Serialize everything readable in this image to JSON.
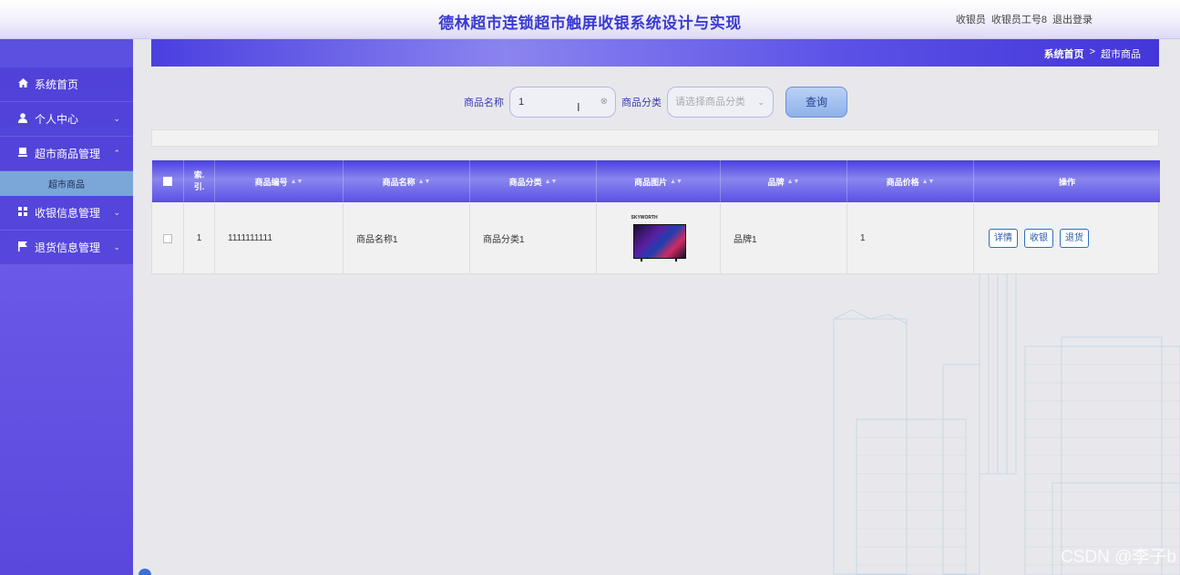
{
  "header": {
    "title": "德林超市连锁超市触屏收银系统设计与实现",
    "user_role": "收银员",
    "user_name": "收银员工号8",
    "logout": "退出登录"
  },
  "sidebar": {
    "items": [
      {
        "label": "系统首页",
        "icon": "home-icon"
      },
      {
        "label": "个人中心",
        "icon": "user-icon"
      },
      {
        "label": "超市商品管理",
        "icon": "product-icon"
      },
      {
        "label": "收银信息管理",
        "icon": "grid-icon"
      },
      {
        "label": "退货信息管理",
        "icon": "flag-icon"
      }
    ],
    "submenu_active": "超市商品"
  },
  "breadcrumb": {
    "home": "系统首页",
    "separator": ">",
    "current": "超市商品"
  },
  "search": {
    "name_label": "商品名称",
    "name_value": "1",
    "category_label": "商品分类",
    "category_placeholder": "请选择商品分类",
    "query_button": "查询"
  },
  "table": {
    "columns": [
      "索引",
      "商品编号",
      "商品名称",
      "商品分类",
      "商品图片",
      "品牌",
      "商品价格",
      "操作"
    ],
    "index_header_line1": "索.",
    "index_header_line2": "引.",
    "rows": [
      {
        "index": "1",
        "code": "1111111111",
        "name": "商品名称1",
        "category": "商品分类1",
        "image_brand": "SKYWORTH",
        "brand": "品牌1",
        "price": "1",
        "actions": [
          "详情",
          "收银",
          "退货"
        ]
      }
    ]
  },
  "watermark": "CSDN @李子b",
  "colors": {
    "accent": "#4c3fe0",
    "title": "#3a3ad0",
    "submenu_active": "#7aa7d8"
  }
}
